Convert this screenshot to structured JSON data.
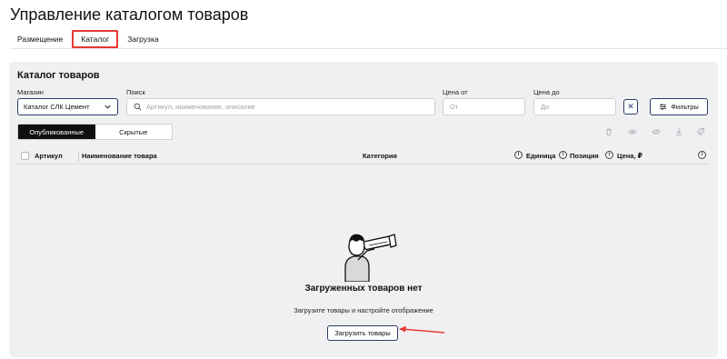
{
  "page": {
    "title": "Управление каталогом товаров"
  },
  "tabs": [
    {
      "label": "Размещение",
      "active": false
    },
    {
      "label": "Каталог",
      "active": true
    },
    {
      "label": "Загрузка",
      "active": false
    }
  ],
  "catalog": {
    "title": "Каталог товаров",
    "store": {
      "label": "Магазин",
      "value": "Каталог СЛК Цемент"
    },
    "search": {
      "label": "Поиск",
      "placeholder": "Артикул, наименование, описание"
    },
    "price_from": {
      "label": "Цена от",
      "placeholder": "От"
    },
    "price_to": {
      "label": "Цена до",
      "placeholder": "До"
    },
    "filters_label": "Фильтры",
    "segments": [
      {
        "label": "Опубликованные",
        "active": true
      },
      {
        "label": "Скрытые",
        "active": false
      }
    ],
    "toolbar_icons": [
      "trash-icon",
      "eye-icon",
      "eye-off-icon",
      "download-icon",
      "tag-icon"
    ],
    "columns": {
      "article": "Артикул",
      "name": "Наименование товара",
      "category": "Категория",
      "unit": "Единица",
      "position": "Позиция",
      "price": "Цена, ₽"
    },
    "empty": {
      "title": "Загруженных товаров нет",
      "subtitle": "Загрузите товары и настройте отображение",
      "button": "Загрузить товары"
    }
  },
  "colors": {
    "accent_dark": "#0f0f0f",
    "highlight_red": "#e53935",
    "border_navy": "#2a3a6a",
    "panel_bg": "#f0f0f2"
  }
}
